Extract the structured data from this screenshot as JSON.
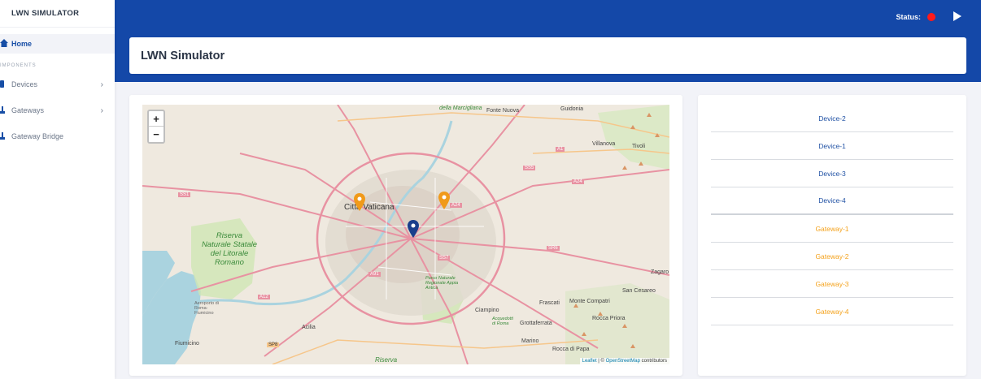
{
  "sidebar": {
    "brand": "LWN SIMULATOR",
    "home_label": "Home",
    "section_header": "IMPONENTS",
    "items": [
      {
        "label": "Devices",
        "has_chevron": true
      },
      {
        "label": "Gateways",
        "has_chevron": true
      },
      {
        "label": "Gateway Bridge",
        "has_chevron": false
      }
    ]
  },
  "topbar": {
    "status_label": "Status:",
    "status_color": "#ff1a1a",
    "accent_color": "#1448a8"
  },
  "page": {
    "title": "LWN Simulator"
  },
  "map": {
    "zoom_in": "+",
    "zoom_out": "−",
    "attribution_leaflet": "Leaflet",
    "attribution_sep": " | © ",
    "attribution_osm": "OpenStreetMap",
    "attribution_tail": " contributors",
    "labels": {
      "vaticana": "Città Vaticana",
      "riserva": "Riserva Naturale Statale del Litorale Romano",
      "fonte": "Fonte Nuova",
      "guidonia": "Guidonia",
      "villanova": "Villanova",
      "tivoli": "Tivoli",
      "frascati": "Frascati",
      "compatri": "Monte Compatri",
      "ciampino": "Ciampino",
      "grottaferrata": "Grottaferrata",
      "roccapriora": "Rocca Priora",
      "sancesareo": "San Cesareo",
      "zagaro": "Zagaro",
      "marino": "Marino",
      "roccapapa": "Rocca di Papa",
      "acilia": "Acilia",
      "fiumicino": "Fiumicino",
      "marcigliana": "della Marcigliana",
      "aeroporto": "Aeroporto di Roma-Fiumicino",
      "appia": "Parco Naturale Regionale Appia Antica",
      "acquedotti": "Acquedotti di Roma",
      "road_a24": "A24",
      "road_ss1": "SS1",
      "road_ss7": "SS7",
      "road_ss5": "SS5",
      "road_ss6": "SR6",
      "road_a1": "A1",
      "road_a12": "A12",
      "road_a91": "A91",
      "road_sp8": "SP8",
      "riserva_bottom": "Riserva"
    },
    "markers": [
      {
        "name": "gateway-marker",
        "color": "#f09a1a"
      },
      {
        "name": "gateway-marker",
        "color": "#f09a1a"
      },
      {
        "name": "device-marker",
        "color": "#1a3e8c"
      }
    ]
  },
  "list": {
    "items": [
      {
        "label": "Device-2",
        "kind": "device"
      },
      {
        "label": "Device-1",
        "kind": "device"
      },
      {
        "label": "Device-3",
        "kind": "device"
      },
      {
        "label": "Device-4",
        "kind": "device"
      },
      {
        "label": "Gateway-1",
        "kind": "gateway"
      },
      {
        "label": "Gateway-2",
        "kind": "gateway"
      },
      {
        "label": "Gateway-3",
        "kind": "gateway"
      },
      {
        "label": "Gateway-4",
        "kind": "gateway"
      }
    ],
    "device_color": "#1d4fa3",
    "gateway_color": "#f4a21c"
  }
}
